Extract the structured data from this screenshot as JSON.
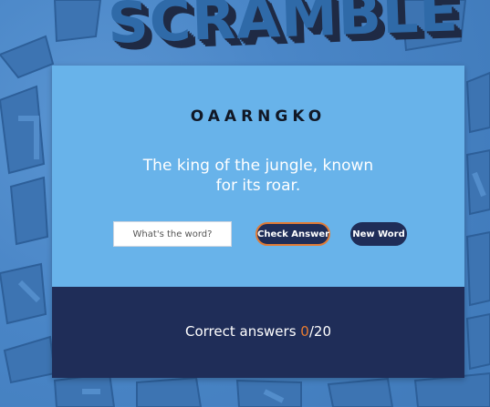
{
  "background": {
    "logo_text": "SCRAMBLE"
  },
  "game": {
    "scrambled_word": "OAARNGKO",
    "hint": "The king of the jungle, known for its roar.",
    "input": {
      "value": "",
      "placeholder": "What's the word?"
    },
    "check_button_label": "Check Answer",
    "new_word_button_label": "New Word"
  },
  "score": {
    "label": "Correct answers",
    "correct": "0",
    "separator": "/",
    "total": "20"
  },
  "colors": {
    "background": "#4a86c7",
    "card_top": "#68b3ea",
    "card_bottom": "#1f2d58",
    "accent": "#e97c30",
    "button": "#1f2d58"
  }
}
